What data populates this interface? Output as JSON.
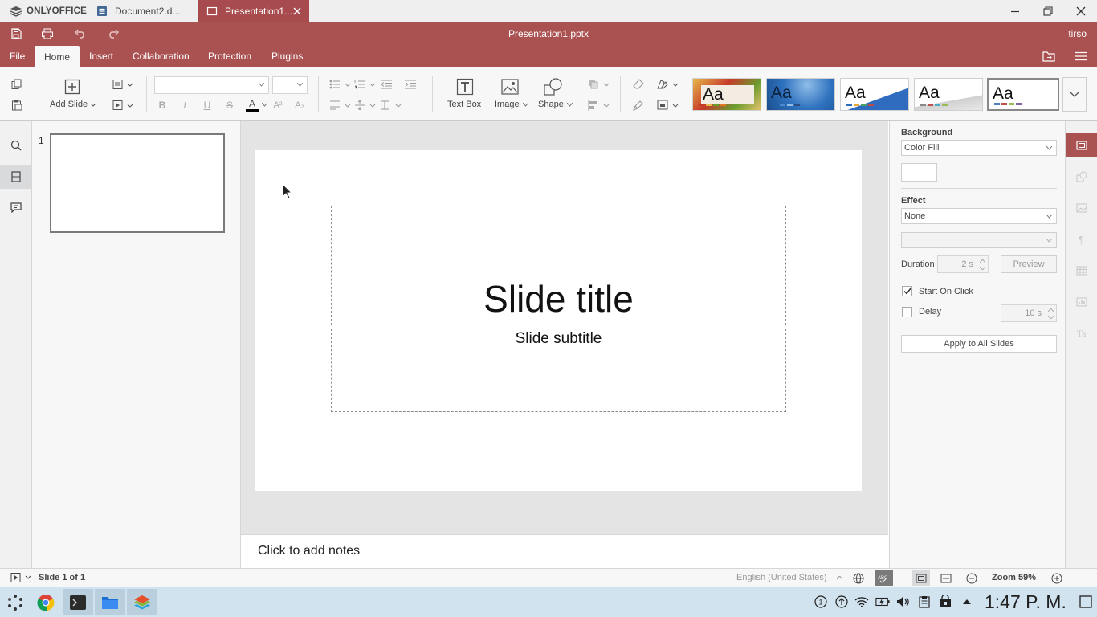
{
  "app": {
    "brand": "ONLYOFFICE",
    "accent": "#aa5252"
  },
  "tabs": [
    {
      "label": "Document2.d...",
      "type": "document",
      "active": false
    },
    {
      "label": "Presentation1....",
      "type": "presentation",
      "active": true
    }
  ],
  "window": {
    "title": "Presentation1.pptx",
    "user": "tirso"
  },
  "menu": [
    "File",
    "Home",
    "Insert",
    "Collaboration",
    "Protection",
    "Plugins"
  ],
  "toolbar": {
    "add_slide": "Add Slide",
    "text_box": "Text Box",
    "image": "Image",
    "shape": "Shape",
    "font_name": "",
    "font_size": "",
    "themes": [
      {
        "name": "theme-1",
        "colors": [
          "#c63a2a",
          "#e8b84a",
          "#6b9c2e",
          "#e07a2a"
        ]
      },
      {
        "name": "theme-2",
        "colors": [
          "#1f5fa8",
          "#4a8ad0",
          "#8fbde8",
          "#2a4f80"
        ]
      },
      {
        "name": "theme-3",
        "colors": [
          "#2f6cc0",
          "#e8a33a",
          "#4aa06a",
          "#c04a4a"
        ]
      },
      {
        "name": "theme-4",
        "colors": [
          "#888888",
          "#c0504d",
          "#4bacc6",
          "#9bbb59"
        ]
      },
      {
        "name": "theme-5",
        "colors": [
          "#4f81bd",
          "#c0504d",
          "#9bbb59",
          "#8064a2"
        ]
      }
    ]
  },
  "thumbnails": [
    {
      "number": "1"
    }
  ],
  "slide": {
    "title": "Slide title",
    "subtitle": "Slide subtitle"
  },
  "notes": {
    "placeholder": "Click to add notes"
  },
  "right_panel": {
    "background_label": "Background",
    "background_value": "Color Fill",
    "effect_label": "Effect",
    "effect_value": "None",
    "effect_type_value": "",
    "duration_label": "Duration",
    "duration_value": "2 s",
    "preview_label": "Preview",
    "start_on_click_label": "Start On Click",
    "start_on_click_checked": true,
    "delay_label": "Delay",
    "delay_checked": false,
    "delay_value": "10 s",
    "apply_all_label": "Apply to All Slides"
  },
  "status": {
    "slide_info": "Slide 1 of 1",
    "language": "English (United States)",
    "zoom": "Zoom 59%"
  },
  "taskbar": {
    "apps": [
      "app-menu",
      "chrome",
      "terminal",
      "files",
      "onlyoffice"
    ],
    "clock": "1:47 P. M."
  }
}
